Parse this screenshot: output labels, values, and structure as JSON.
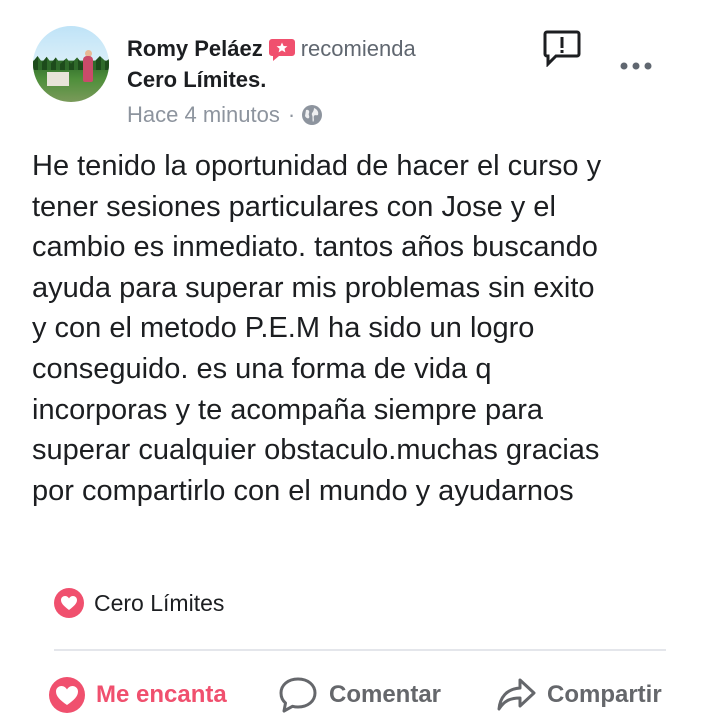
{
  "post": {
    "author": "Romy Peláez",
    "verb": "recomienda",
    "page_name": "Cero Límites.",
    "timestamp": "Hace 4 minutos",
    "separator": "·",
    "body": "He tenido la oportunidad de hacer el curso y\ntener sesiones particulares con Jose y el\ncambio es inmediato. tantos años buscando\nayuda para superar mis problemas sin exito\ny con el metodo P.E.M ha sido un logro\nconseguido. es una forma de vida q\nincorporas y te acompaña siempre para\nsuperar cualquier obstaculo.muchas gracias\npor compartirlo con el mundo y ayudarnos"
  },
  "reactions": {
    "icon": "heart-icon",
    "names": "Cero Límites"
  },
  "actions": {
    "like_label": "Me encanta",
    "comment_label": "Comentar",
    "share_label": "Compartir"
  },
  "colors": {
    "accent": "#f0506e",
    "secondary_text": "#606770",
    "meta_text": "#8d949e"
  },
  "icons": [
    "recommend-star-icon",
    "report-icon",
    "more-options-icon",
    "globe-icon",
    "heart-icon",
    "comment-icon",
    "share-icon"
  ]
}
